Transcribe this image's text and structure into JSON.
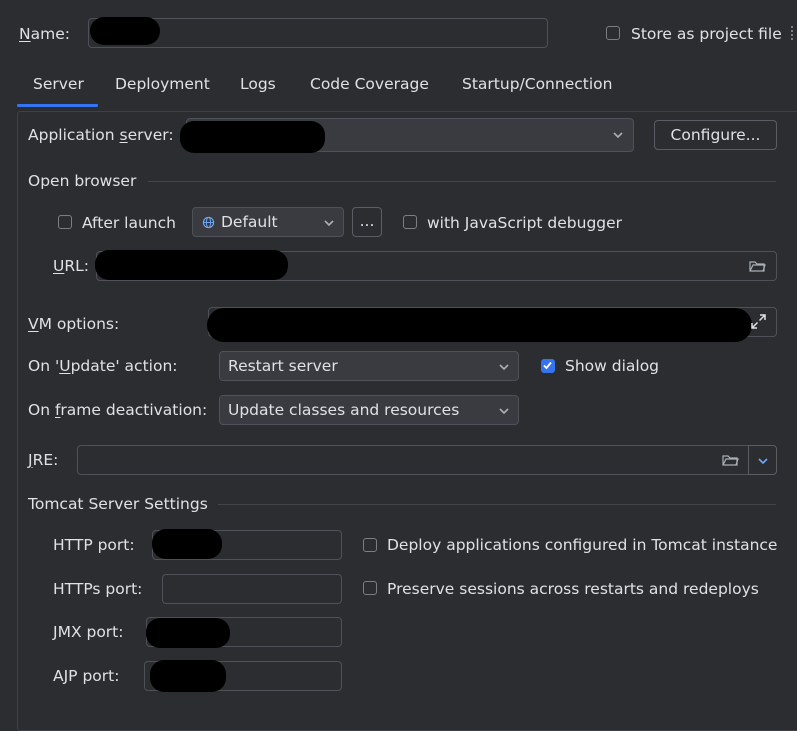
{
  "header": {
    "name_label": "Name:",
    "name_value": "",
    "store_label": "Store as project file",
    "store_checked": false
  },
  "tabs": [
    {
      "label": "Server",
      "selected": true
    },
    {
      "label": "Deployment",
      "selected": false
    },
    {
      "label": "Logs",
      "selected": false
    },
    {
      "label": "Code Coverage",
      "selected": false
    },
    {
      "label": "Startup/Connection",
      "selected": false
    }
  ],
  "server": {
    "app_server_label": "Application server:",
    "app_server_value": "",
    "configure_label": "Configure...",
    "open_browser_title": "Open browser",
    "after_launch_label": "After launch",
    "after_launch_checked": false,
    "browser_value": "Default",
    "ellipsis_label": "...",
    "js_debugger_label": "with JavaScript debugger",
    "js_debugger_checked": false,
    "url_label": "URL:",
    "url_value": "",
    "vm_options_label": "VM options:",
    "vm_options_value": "",
    "on_update_label": "On 'Update' action:",
    "on_update_value": "Restart server",
    "show_dialog_label": "Show dialog",
    "show_dialog_checked": true,
    "on_frame_label": "On frame deactivation:",
    "on_frame_value": "Update classes and resources",
    "jre_label": "JRE:",
    "jre_value": ""
  },
  "tomcat": {
    "title": "Tomcat Server Settings",
    "http_port_label": "HTTP port:",
    "https_port_label": "HTTPs port:",
    "jmx_port_label": "JMX port:",
    "ajp_port_label": "AJP port:",
    "deploy_label": "Deploy applications configured in Tomcat instance",
    "deploy_checked": false,
    "preserve_label": "Preserve sessions across restarts and redeploys",
    "preserve_checked": false
  },
  "colors": {
    "background": "#2b2d30",
    "accent": "#3574f0",
    "text": "#dfe1e5",
    "border": "#4e5157"
  },
  "icons": [
    "globe-icon",
    "folder-icon",
    "expand-icon",
    "chevron-down-icon",
    "checkmark-icon"
  ]
}
